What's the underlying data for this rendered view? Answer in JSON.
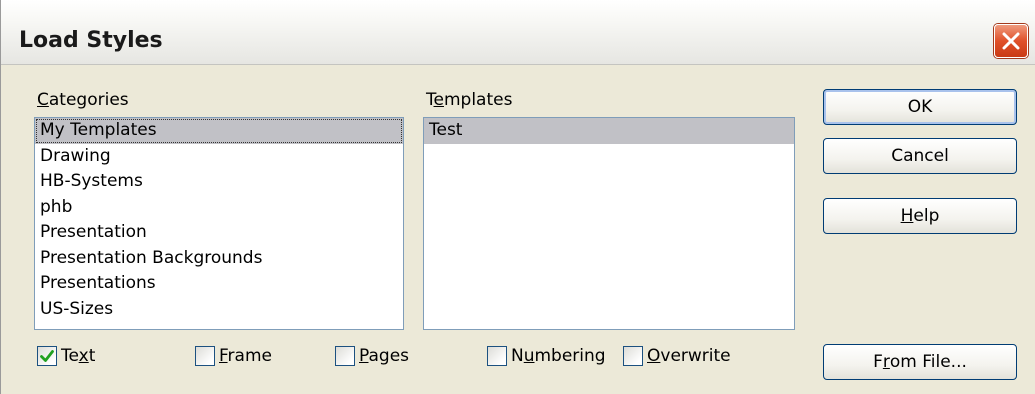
{
  "window": {
    "title": "Load Styles"
  },
  "categories": {
    "label": "Categories",
    "mnemonic": "C",
    "items": [
      "My Templates",
      "Drawing",
      "HB-Systems",
      "phb",
      "Presentation",
      "Presentation Backgrounds",
      "Presentations",
      "US-Sizes"
    ],
    "selected": "My Templates"
  },
  "templates": {
    "label": "Templates",
    "mnemonic": "e",
    "items": [
      "Test"
    ],
    "selected": "Test"
  },
  "buttons": {
    "ok": "OK",
    "cancel": "Cancel",
    "help": "Help",
    "from_file": "From File..."
  },
  "options": [
    {
      "label": "Text",
      "checked": true
    },
    {
      "label": "Frame",
      "checked": false
    },
    {
      "label": "Pages",
      "checked": false
    },
    {
      "label": "Numbering",
      "checked": false
    },
    {
      "label": "Overwrite",
      "checked": false
    }
  ],
  "colors": {
    "selection": "#c1c1c6",
    "list_border": "#7f9db9",
    "close_button": "#e0512a",
    "checkmark": "#21a121"
  }
}
